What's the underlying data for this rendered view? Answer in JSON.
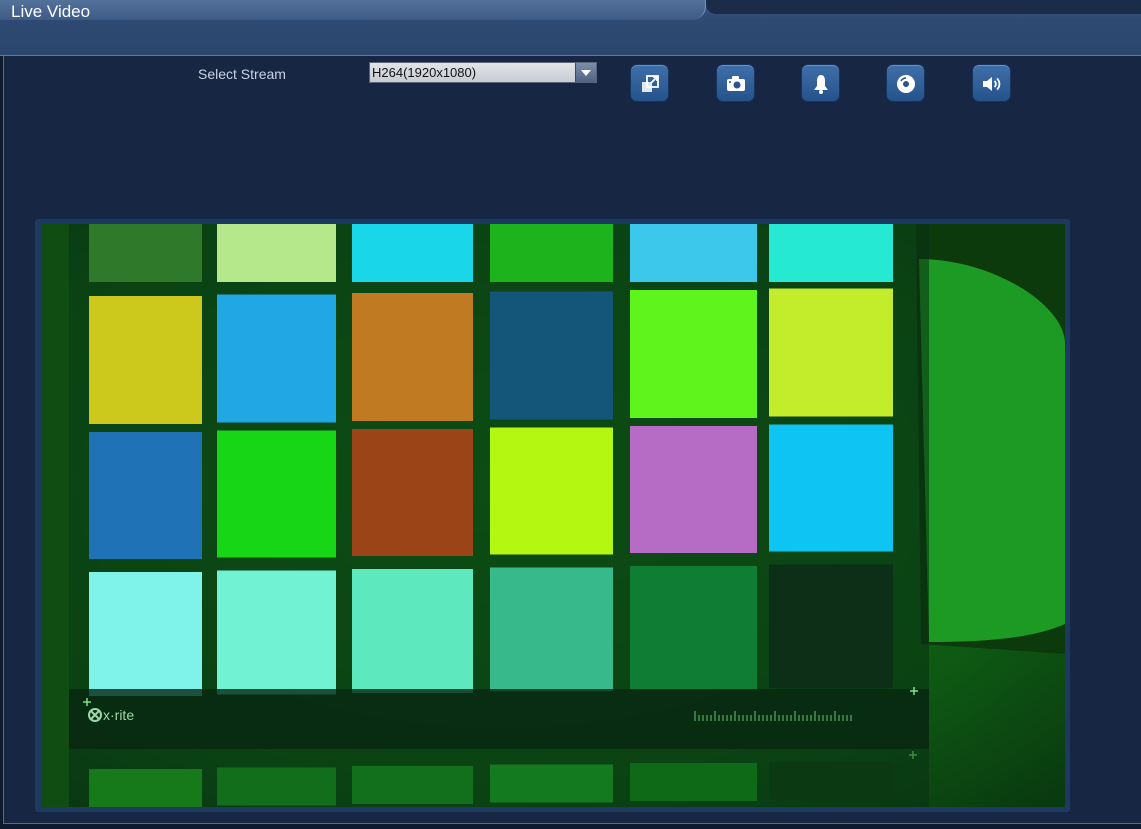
{
  "window": {
    "title": "Live Video"
  },
  "stream": {
    "label": "Select Stream",
    "selected": "H264(1920x1080)"
  },
  "toolbar": {
    "buttons": [
      {
        "name": "fullscreen-button",
        "icon": "fullscreen-icon"
      },
      {
        "name": "snapshot-button",
        "icon": "camera-icon"
      },
      {
        "name": "alarm-button",
        "icon": "bell-icon"
      },
      {
        "name": "record-button",
        "icon": "disc-icon"
      },
      {
        "name": "audio-button",
        "icon": "speaker-icon"
      }
    ]
  },
  "video": {
    "brand": "x·rite",
    "rows": [
      [
        "#2f7a2a",
        "#b4e88a",
        "#19d6e8",
        "#1cb31c",
        "#3cc8ea",
        "#25e9d2"
      ],
      [
        "#cdc81c",
        "#21a7e3",
        "#c07a22",
        "#13567a",
        "#5ff51c",
        "#c3ec2a"
      ],
      [
        "#1f72b6",
        "#16d616",
        "#9a4417",
        "#b4f812",
        "#b66bc4",
        "#0ec4f2"
      ],
      [
        "#7ff2e9",
        "#71f3d3",
        "#5ee8be",
        "#37b98c",
        "#0f7d33",
        "#0d2f18"
      ],
      [
        "#167a1a",
        "#126e1b",
        "#12701c",
        "#137a1f",
        "#0f6a18",
        "#0b3a12"
      ]
    ]
  }
}
